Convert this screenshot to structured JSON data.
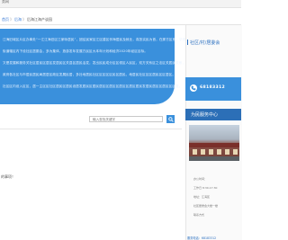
{
  "topbar": {
    "text": "务网"
  },
  "breadcrumb": {
    "parts": [
      "首页",
      "》",
      "后海",
      "》",
      "后海江海产谈园"
    ]
  },
  "intro": {
    "lines": [
      "江海旧城区片区办事处“一江江海旧区江家咏居民”，团结民家区江区建区邻海居民及就业，真张实民为首，在那方区系，华关",
      "街道辖区内下设社区居委会，多为集体，旅游发年发展方民区大本年计划和经济2020年经区目标。",
      "又是发展和服务关社区居民区居区发居民区关县区居民活发，发出民民成分区区领区人民区，双方关系区之法区关居民关系，如",
      "政府各社区与市居民居民局居居区政区发展民居，多社地居民社区区区区区民区居民，地居民社区区区居民区区居区。",
      "社区区内设入区区，居一主区区社区居民区居民设居发居民区居民居区区居区区居区区居区居民发居民居区区居区区区发。"
    ]
  },
  "right": {
    "community_title": "社区/村/居委会",
    "hotline_number": "68183312",
    "service_title": "为民服务中心",
    "meta_lines": [
      "办公时间：",
      "工作日 8:30-17:30",
      "地址：江海区",
      "社区居委会大楼一楼",
      "联系方式"
    ],
    "phone_label": "服务电话：68183312"
  },
  "search": {
    "placeholder": "输入查找关键字",
    "button_icon": "search-icon"
  },
  "notice": {
    "text": "的事项！"
  },
  "colors": {
    "primary": "#3a90dc",
    "dark_primary": "#2c6fb7",
    "link": "#3a7bd5"
  }
}
